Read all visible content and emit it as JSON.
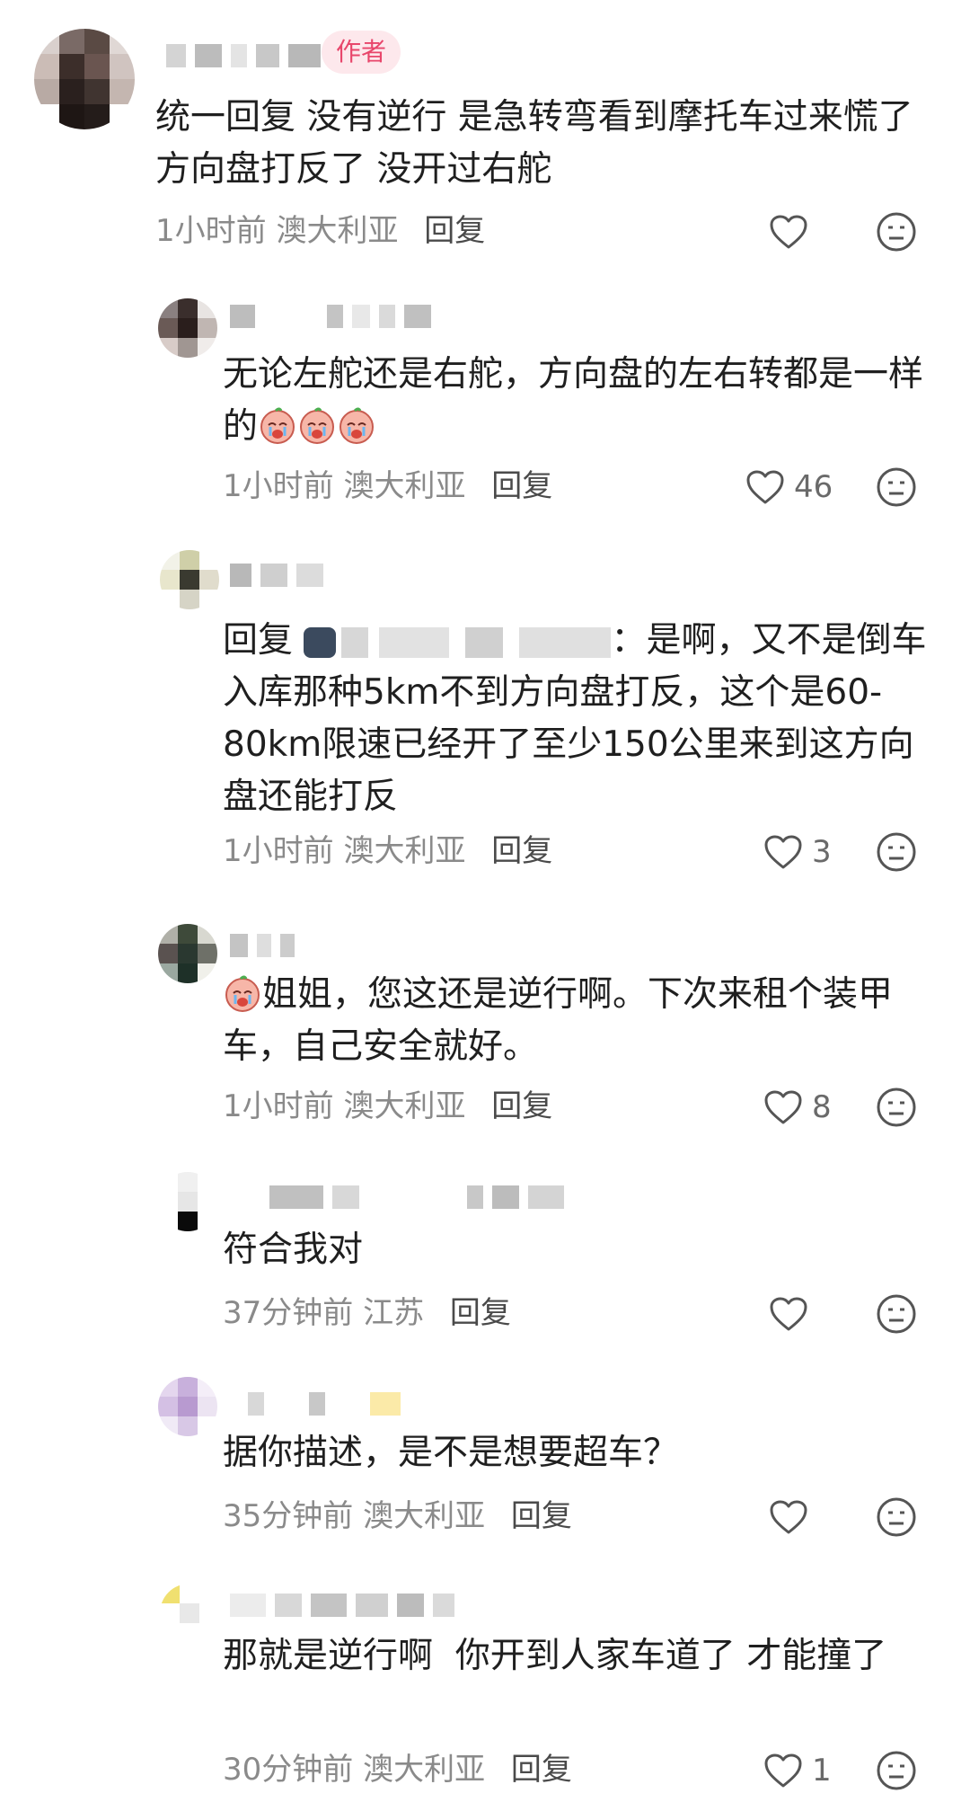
{
  "labels": {
    "author_badge": "作者",
    "reply": "回复"
  },
  "comments": [
    {
      "id": "c1",
      "is_author": true,
      "text": "统一回复 没有逆行 是急转弯看到摩托车过来慌了方向盘打反了 没开过右舵",
      "time": "1小时前",
      "location": "澳大利亚",
      "likes": ""
    },
    {
      "id": "c2",
      "text": "无论左舵还是右舵，方向盘的左右转都是一样的",
      "emoji_suffix": [
        "crying-emoji",
        "crying-emoji",
        "crying-emoji"
      ],
      "time": "1小时前",
      "location": "澳大利亚",
      "likes": "46"
    },
    {
      "id": "c3",
      "reply_prefix": "回复",
      "reply_sep": "：",
      "text": "是啊，又不是倒车入库那种5km不到方向盘打反，这个是60-80km限速已经开了至少150公里来到这方向盘还能打反",
      "time": "1小时前",
      "location": "澳大利亚",
      "likes": "3"
    },
    {
      "id": "c4",
      "emoji_prefix": "crying-emoji",
      "text": "姐姐，您这还是逆行啊。下次来租个装甲车，自己安全就好。",
      "time": "1小时前",
      "location": "澳大利亚",
      "likes": "8"
    },
    {
      "id": "c5",
      "text": "符合我对",
      "time": "37分钟前",
      "location": "江苏",
      "likes": ""
    },
    {
      "id": "c6",
      "text": "据你描述，是不是想要超车？",
      "time": "35分钟前",
      "location": "澳大利亚",
      "likes": ""
    },
    {
      "id": "c7",
      "text": "那就是逆行啊  你开到人家车道了 才能撞了",
      "time": "30分钟前",
      "location": "澳大利亚",
      "likes": "1"
    }
  ],
  "colors": {
    "author_badge_bg": "#fde8ec",
    "author_badge_text": "#e8466b",
    "meta_text": "#8a8a8a"
  }
}
